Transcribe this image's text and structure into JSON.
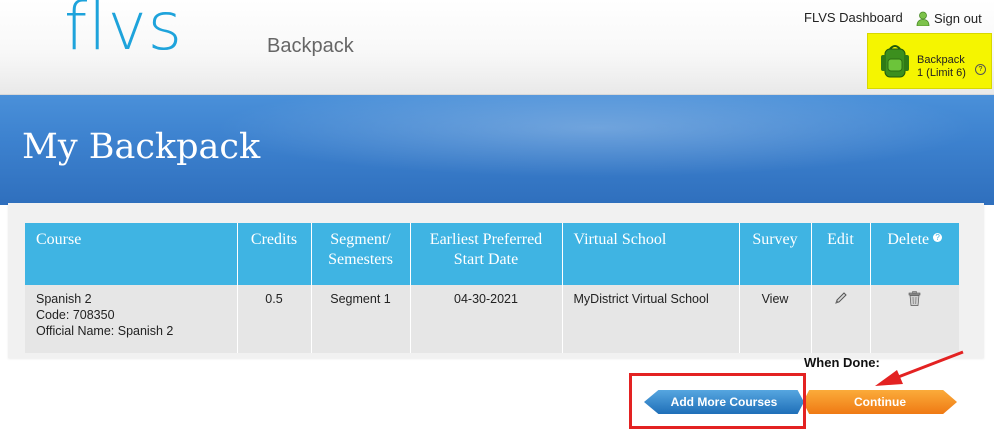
{
  "header": {
    "logo": "flvs",
    "page_label": "Backpack",
    "dashboard_link": "FLVS Dashboard",
    "sign_out": "Sign out",
    "backpack_widget": {
      "title": "Backpack",
      "count": "1 (Limit 6)",
      "help": "?"
    }
  },
  "banner": {
    "title": "My Backpack"
  },
  "table": {
    "columns": [
      {
        "label_1": "Course",
        "label_2": ""
      },
      {
        "label_1": "Credits",
        "label_2": ""
      },
      {
        "label_1": "Segment/",
        "label_2": "Semesters"
      },
      {
        "label_1": "Earliest Preferred",
        "label_2": "Start Date"
      },
      {
        "label_1": "Virtual School",
        "label_2": ""
      },
      {
        "label_1": "Survey",
        "label_2": ""
      },
      {
        "label_1": "Edit",
        "label_2": ""
      },
      {
        "label_1": "Delete",
        "label_2": ""
      }
    ],
    "delete_help": "?",
    "rows": [
      {
        "course_name": "Spanish 2",
        "course_code": "Code: 708350",
        "official_name": "Official Name: Spanish 2",
        "credits": "0.5",
        "segment": "Segment 1",
        "start_date": "04-30-2021",
        "virtual_school": "MyDistrict Virtual School",
        "survey": "View",
        "edit_icon": "pencil-icon",
        "delete_icon": "trash-icon"
      }
    ]
  },
  "footer": {
    "when_done": "When Done:",
    "add_more_label": "Add More Courses",
    "continue_label": "Continue"
  },
  "colors": {
    "logo": "#1ea3db",
    "table_header": "#3fb4e3",
    "highlight": "#f5f500",
    "annotation": "#e32222",
    "continue": "#f08a1c",
    "add_more": "#2f7fc4"
  }
}
